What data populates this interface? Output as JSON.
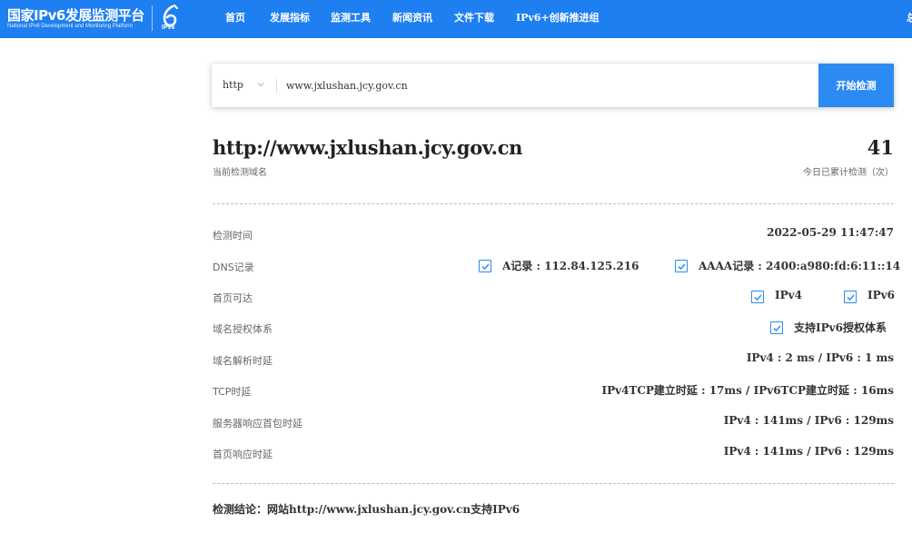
{
  "header": {
    "logo_title": "国家IPv6发展监测平台",
    "logo_subtitle": "National IPv6 Development and Monitoring Platform",
    "logo_mark_text": "IPv6",
    "nav": [
      "首页",
      "发展指标",
      "监测工具",
      "新闻资讯",
      "文件下载",
      "IPv6+创新推进组"
    ],
    "nav_edge": "总"
  },
  "search": {
    "protocol": "http",
    "value": "www.jxlushan.jcy.gov.cn",
    "button": "开始检测"
  },
  "result": {
    "domain": "http://www.jxlushan.jcy.gov.cn",
    "domain_label": "当前检测域名",
    "count": "41",
    "count_label": "今日已累计检测（次）",
    "rows": {
      "time": {
        "label": "检测时间",
        "value": "2022-05-29 11:47:47"
      },
      "dns": {
        "label": "DNS记录",
        "a": "A记录 : 112.84.125.216",
        "aaaa": "AAAA记录 : 2400:a980:fd:6:11::14"
      },
      "reach": {
        "label": "首页可达",
        "ipv4": "IPv4",
        "ipv6": "IPv6"
      },
      "auth": {
        "label": "域名授权体系",
        "value": "支持IPv6授权体系"
      },
      "resolve": {
        "label": "域名解析时延",
        "value": "IPv4 : 2 ms / IPv6 : 1 ms"
      },
      "tcp": {
        "label": "TCP时延",
        "value": "IPv4TCP建立时延 : 17ms / IPv6TCP建立时延 : 16ms"
      },
      "first_packet": {
        "label": "服务器响应首包时延",
        "value": "IPv4 : 141ms / IPv6 : 129ms"
      },
      "page": {
        "label": "首页响应时延",
        "value": "IPv4 : 141ms / IPv6 : 129ms"
      }
    },
    "conclusion": "检测结论：网站http://www.jxlushan.jcy.gov.cn支持IPv6"
  },
  "colors": {
    "primary": "#1e7ff0",
    "button": "#2b8bf2",
    "check": "#2b8bf2"
  }
}
